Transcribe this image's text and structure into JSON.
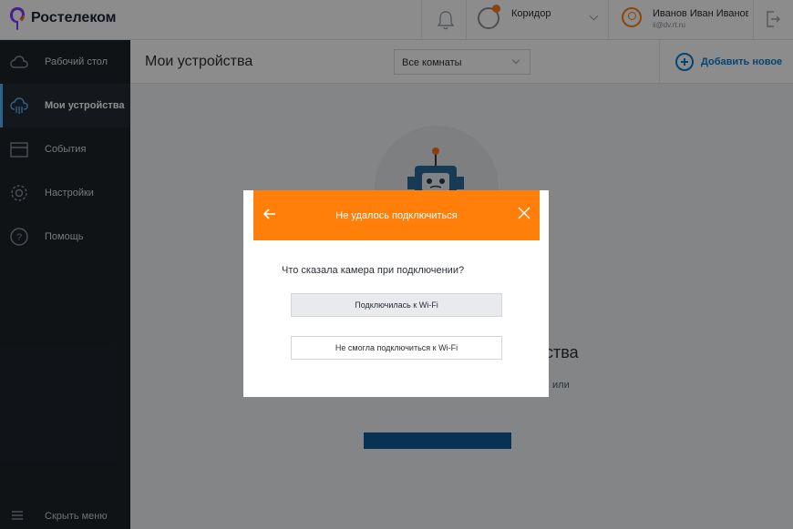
{
  "header": {
    "brand": "Ростелеком",
    "room_selector": {
      "label": "Коридор"
    },
    "user": {
      "name": "Иванов Иван Иванович",
      "email": "ii@dv.rt.ru"
    }
  },
  "sidebar": {
    "items": [
      {
        "label": "Рабочий стол",
        "icon": "cloud-icon"
      },
      {
        "label": "Мои устройства",
        "icon": "cloud-devices-icon",
        "active": true
      },
      {
        "label": "События",
        "icon": "calendar-icon"
      },
      {
        "label": "Настройки",
        "icon": "gear-icon"
      },
      {
        "label": "Помощь",
        "icon": "help-icon"
      }
    ],
    "hide_menu_label": "Скрыть меню"
  },
  "main": {
    "title": "Мои устройства",
    "filter": {
      "value": "Все комнаты"
    },
    "add_new_label": "Добавить новое",
    "empty_title": "ства",
    "empty_text": "или"
  },
  "modal": {
    "title": "Не удалось подключиться",
    "question": "Что сказала камера при подключении?",
    "options": [
      "Подключилась к Wi-Fi",
      "Не смогла подключиться к Wi-Fi"
    ]
  },
  "colors": {
    "accent_orange": "#ff7f0a",
    "link_blue": "#0a7fd6",
    "sidebar_bg": "#1d2329"
  }
}
